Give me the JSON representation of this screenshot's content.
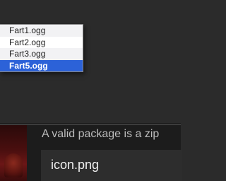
{
  "dropdown": {
    "items": [
      {
        "label": "Fart1.ogg",
        "selected": false
      },
      {
        "label": "Fart2.ogg",
        "selected": false
      },
      {
        "label": "Fart3.ogg",
        "selected": false
      },
      {
        "label": "Fart5.ogg",
        "selected": true
      }
    ],
    "selected_color": "#2c62d8"
  },
  "page": {
    "helper_text": "A valid package is a zip",
    "file_name": "icon.png"
  }
}
